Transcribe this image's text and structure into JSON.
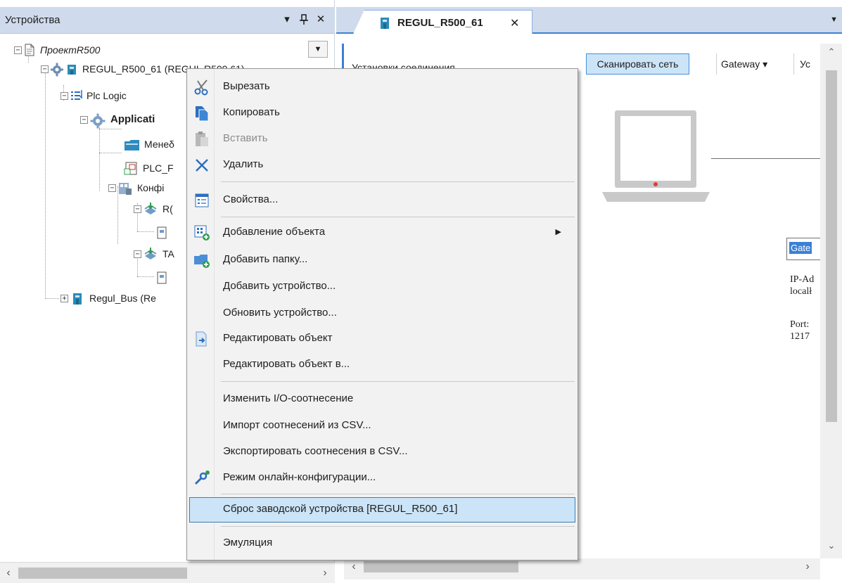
{
  "left_panel": {
    "title": "Устройства",
    "dropdown_glyph": "▾",
    "pin_glyph": "ᴪ",
    "close_glyph": "✕",
    "tree": [
      {
        "label": "ПроектR500",
        "icon": "project-icon"
      },
      {
        "label": "REGUL_R500_61 (REGUL R500 61)",
        "icon": "device-icon"
      },
      {
        "label": "Plc Logic",
        "icon": "plc-logic-icon"
      },
      {
        "label": "Applicati",
        "icon": "application-icon"
      },
      {
        "label": "Менеδ",
        "icon": "library-manager-icon"
      },
      {
        "label": "PLC_F",
        "icon": "program-icon"
      },
      {
        "label": "Конфі",
        "icon": "configuration-icon"
      },
      {
        "label": "R(",
        "icon": "task-icon"
      },
      {
        "label": "",
        "icon": "task-call-icon"
      },
      {
        "label": "TA",
        "icon": "task-icon"
      },
      {
        "label": "",
        "icon": "task-call-icon"
      },
      {
        "label": "Regul_Bus (Re",
        "icon": "bus-icon"
      }
    ]
  },
  "editor": {
    "tab_title": "REGUL_R500_61",
    "tab_close": "✕",
    "connection_label": "Установки соединения",
    "scan_button": "Сканировать сеть",
    "gateway_button": "Gateway ▾",
    "device_button": "Ус",
    "gateway_node_name": "Gate",
    "ip_label": "IP-Ad",
    "ip_value": "localł",
    "port_label": "Port:",
    "port_value": "1217"
  },
  "context_menu": {
    "items": [
      {
        "label": "Вырезать",
        "icon": "scissors-icon",
        "enabled": true
      },
      {
        "label": "Копировать",
        "icon": "copy-icon",
        "enabled": true
      },
      {
        "label": "Вставить",
        "icon": "paste-icon",
        "enabled": false
      },
      {
        "label": "Удалить",
        "icon": "delete-icon",
        "enabled": true
      },
      {
        "label": "Свойства...",
        "icon": "properties-icon",
        "enabled": true
      },
      {
        "label": "Добавление объекта",
        "icon": "add-object-icon",
        "enabled": true,
        "submenu": true
      },
      {
        "label": "Добавить папку...",
        "icon": "add-folder-icon",
        "enabled": true
      },
      {
        "label": "Добавить устройство...",
        "icon": "",
        "enabled": true
      },
      {
        "label": "Обновить устройство...",
        "icon": "",
        "enabled": true
      },
      {
        "label": "Редактировать объект",
        "icon": "edit-object-icon",
        "enabled": true
      },
      {
        "label": "Редактировать объект в...",
        "icon": "",
        "enabled": true
      },
      {
        "label": "Изменить I/O-соотнесение",
        "icon": "",
        "enabled": true
      },
      {
        "label": "Импорт соотнесений из CSV...",
        "icon": "",
        "enabled": true
      },
      {
        "label": "Экспортировать соотнесения в CSV...",
        "icon": "",
        "enabled": true
      },
      {
        "label": "Режим онлайн-конфигурации...",
        "icon": "online-config-icon",
        "enabled": true
      },
      {
        "label": "Сброс заводской устройства [REGUL_R500_61]",
        "icon": "",
        "enabled": true,
        "highlighted": true
      },
      {
        "label": "Эмуляция",
        "icon": "",
        "enabled": true
      }
    ],
    "submenu_arrow": "▶"
  },
  "colors": {
    "header_bg": "#cfdaec",
    "accent": "#3a80d6",
    "menu_highlight": "#cce4f7"
  }
}
